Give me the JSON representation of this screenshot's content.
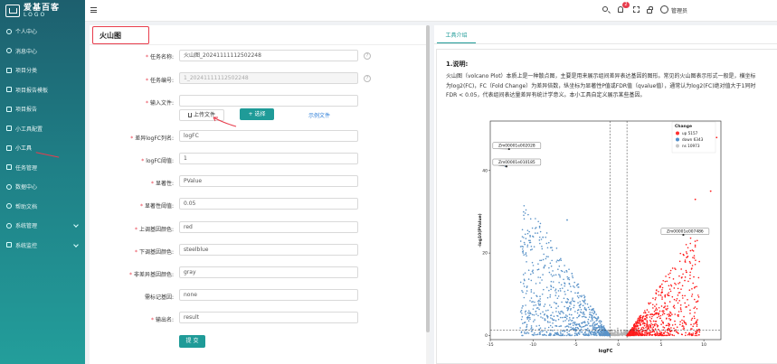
{
  "sidebar": {
    "logo_title": "爱基百客",
    "logo_sub": "LOGO",
    "items": [
      {
        "label": "个人中心"
      },
      {
        "label": "消息中心"
      },
      {
        "label": "项目分类"
      },
      {
        "label": "项目报告模板"
      },
      {
        "label": "项目报告"
      },
      {
        "label": "小工具配置"
      },
      {
        "label": "小工具"
      },
      {
        "label": "任务管理"
      },
      {
        "label": "数据中心"
      },
      {
        "label": "帮助文档"
      },
      {
        "label": "系统管理"
      },
      {
        "label": "系统监控"
      }
    ]
  },
  "topbar": {
    "notification_count": "2",
    "user_name": "管理员"
  },
  "page": {
    "title": "火山图"
  },
  "form": {
    "task_name": {
      "label": "任务名称:",
      "value": "火山图_20241111112502248"
    },
    "task_id": {
      "label": "任务编号:",
      "value": "1_20241111112502248"
    },
    "input_file": {
      "label": "输入文件:",
      "value": ""
    },
    "upload_label": "上传文件",
    "select_label": "+ 选择",
    "example_label": "示例文件",
    "logfc_col": {
      "label": "差异logFC列名:",
      "value": "logFC"
    },
    "logfc_threshold": {
      "label": "logFC阈值:",
      "value": "1"
    },
    "significance": {
      "label": "显著性:",
      "value": "PValue"
    },
    "sig_threshold": {
      "label": "显著性阈值:",
      "value": "0.05"
    },
    "up_color": {
      "label": "上调基因颜色:",
      "value": "red"
    },
    "down_color": {
      "label": "下调基因颜色:",
      "value": "steelblue"
    },
    "ns_color": {
      "label": "非差异基因颜色:",
      "value": "gray"
    },
    "label_genes": {
      "label": "需标记基因:",
      "value": "none"
    },
    "output_name": {
      "label": "输出名:",
      "value": "result"
    },
    "submit_label": "提 交"
  },
  "intro": {
    "tab_label": "工具介绍",
    "section_title": "1.说明:",
    "description": "火山图（volcano Plot）本质上是一种散点图，主要是用来展示组间差异表达基因的图形。常见的火山图表示形式一般是，横坐标为log2(FC)，FC（Fold Change）为差异倍数，纵坐标为显著性P值或FDR值（qvalue值），通常认为log2(FC)绝对值大于1同时FDR < 0.05，代表组间表达量差异有统计学意义。本小工具自定义展示某些基因。"
  },
  "chart_data": {
    "type": "scatter",
    "title": "",
    "xlabel": "logFC",
    "ylabel": "-log10(PValue)",
    "xlim": [
      -15,
      12
    ],
    "ylim": [
      -1,
      52
    ],
    "xticks": [
      -15,
      -10,
      -5,
      0,
      5,
      10
    ],
    "yticks": [
      0,
      20,
      40
    ],
    "thresholds": {
      "logfc": [
        -1,
        1
      ],
      "pvalue_line": 0.05
    },
    "legend": {
      "title": "Change",
      "position": "top-right",
      "entries": [
        {
          "name": "up 5157",
          "color": "#ff3030"
        },
        {
          "name": "down 6343",
          "color": "#4f8fcb"
        },
        {
          "name": "ns 10973",
          "color": "#c8c8c8"
        }
      ]
    },
    "colors": {
      "up": "#ff1a1a",
      "down": "#5b93c8",
      "ns": "#b5b5b5"
    },
    "annotations": [
      {
        "label": "Zm00001e002028",
        "x": -12.8,
        "y": 45.2
      },
      {
        "label": "Zm00001e010185",
        "x": -13.1,
        "y": 41.0
      },
      {
        "label": "Zm00001e007486",
        "x": 7.6,
        "y": 24.4
      }
    ]
  }
}
